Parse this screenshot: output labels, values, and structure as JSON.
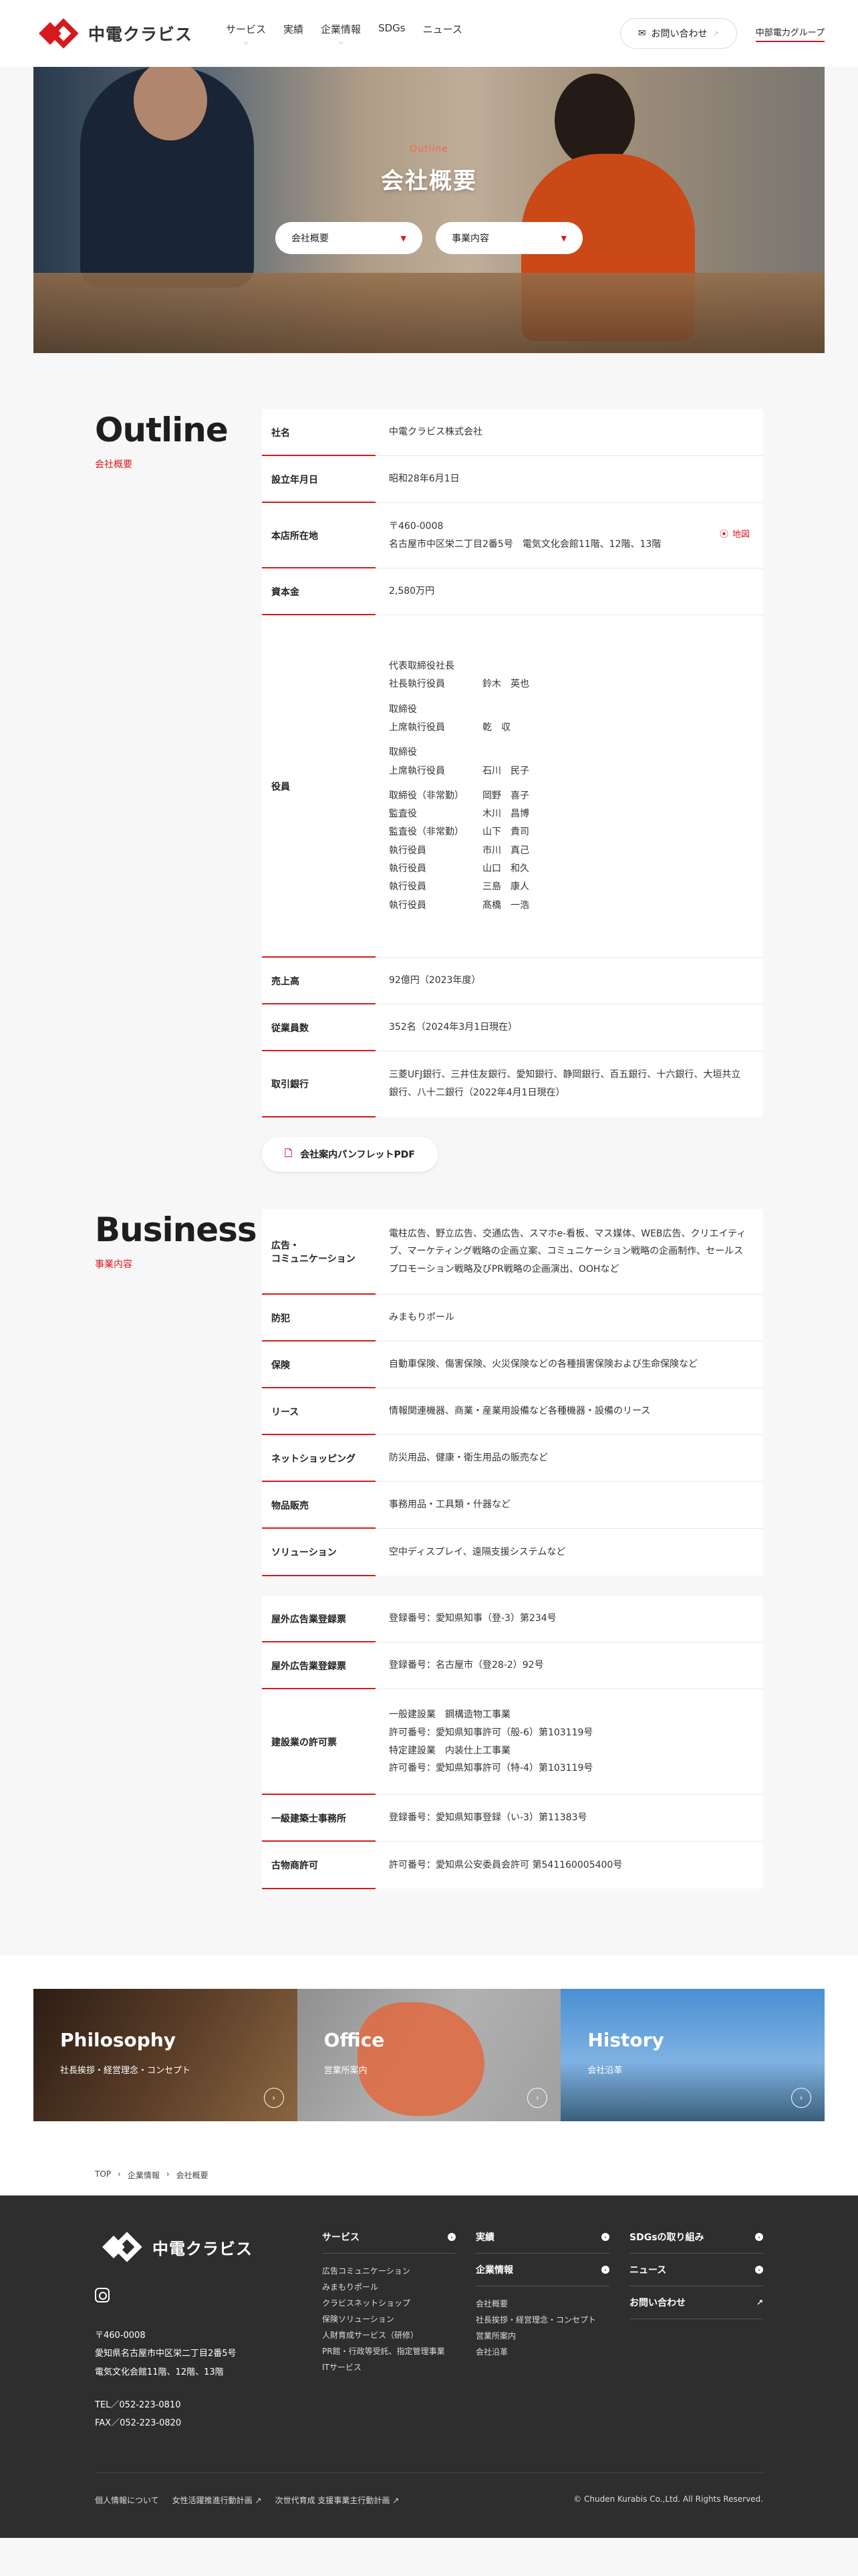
{
  "header": {
    "logo_text": "中電クラビス",
    "nav": [
      {
        "label": "サービス",
        "has_dropdown": true
      },
      {
        "label": "実績",
        "has_dropdown": false
      },
      {
        "label": "企業情報",
        "has_dropdown": true
      },
      {
        "label": "SDGs",
        "has_dropdown": false
      },
      {
        "label": "ニュース",
        "has_dropdown": false
      }
    ],
    "contact_label": "お問い合わせ",
    "group_label": "中部電力グループ"
  },
  "hero": {
    "subtitle": "Outline",
    "title": "会社概要",
    "select1": "会社概要",
    "select2": "事業内容"
  },
  "outline": {
    "title": "Outline",
    "subtitle": "会社概要",
    "rows": {
      "name": {
        "label": "社名",
        "value": "中電クラビス株式会社"
      },
      "founded": {
        "label": "設立年月日",
        "value": "昭和28年6月1日"
      },
      "address": {
        "label": "本店所在地",
        "line1": "〒460-0008",
        "line2": "名古屋市中区栄二丁目2番5号　電気文化会館11階、12階、13階",
        "map_label": "地図"
      },
      "capital": {
        "label": "資本金",
        "value": "2,580万円"
      },
      "officers": {
        "label": "役員"
      },
      "sales": {
        "label": "売上高",
        "value": "92億円（2023年度）"
      },
      "employees": {
        "label": "従業員数",
        "value": "352名（2024年3月1日現在）"
      },
      "banks": {
        "label": "取引銀行",
        "value": "三菱UFJ銀行、三井住友銀行、愛知銀行、静岡銀行、百五銀行、十六銀行、大垣共立銀行、八十二銀行（2022年4月1日現在）"
      }
    },
    "officers": {
      "g1_title": "代表取締役社長",
      "g1_role": "社長執行役員",
      "g1_name": "鈴木　英也",
      "g2_title": "取締役",
      "g2_role": "上席執行役員",
      "g2_name": "乾　収",
      "g3_title": "取締役",
      "g3_role": "上席執行役員",
      "g3_name": "石川　民子",
      "l1_role": "取締役（非常勤）",
      "l1_name": "岡野　喜子",
      "l2_role": "監査役",
      "l2_name": "木川　昌博",
      "l3_role": "監査役（非常勤）",
      "l3_name": "山下　貴司",
      "l4_role": "執行役員",
      "l4_name": "市川　真己",
      "l5_role": "執行役員",
      "l5_name": "山口　和久",
      "l6_role": "執行役員",
      "l6_name": "三島　康人",
      "l7_role": "執行役員",
      "l7_name": "髙橋　一浩"
    },
    "pdf_label": "会社案内パンフレットPDF"
  },
  "business": {
    "title": "Business",
    "subtitle": "事業内容",
    "rows": {
      "ad": {
        "label_l1": "広告・",
        "label_l2": "コミュニケーション",
        "value": "電柱広告、野立広告、交通広告、スマホe-看板、マス媒体、WEB広告、クリエイティブ、マーケティング戦略の企画立案、コミュニケーション戦略の企画制作、セールスプロモーション戦略及びPR戦略の企画演出、OOHなど"
      },
      "security": {
        "label": "防犯",
        "value": "みまもりポール"
      },
      "insurance": {
        "label": "保険",
        "value": "自動車保険、傷害保険、火災保険などの各種損害保険および生命保険など"
      },
      "lease": {
        "label": "リース",
        "value": "情報関連機器、商業・産業用設備など各種機器・設備のリース"
      },
      "shopping": {
        "label": "ネットショッピング",
        "value": "防災用品、健康・衛生用品の販売など"
      },
      "goods": {
        "label": "物品販売",
        "value": "事務用品・工具類・什器など"
      },
      "solution": {
        "label": "ソリューション",
        "value": "空中ディスプレイ、遠隔支援システムなど"
      }
    },
    "licenses": {
      "outdoor1": {
        "label": "屋外広告業登録票",
        "value": "登録番号：愛知県知事（登-3）第234号"
      },
      "outdoor2": {
        "label": "屋外広告業登録票",
        "value": "登録番号：名古屋市（登28-2）92号"
      },
      "construction": {
        "label": "建設業の許可票",
        "v1": "一般建設業　鋼構造物工事業",
        "v2": "許可番号：愛知県知事許可（般-6）第103119号",
        "v3": "特定建設業　内装仕上工事業",
        "v4": "許可番号：愛知県知事許可（特-4）第103119号"
      },
      "architect": {
        "label": "一級建築士事務所",
        "value": "登録番号：愛知県知事登録（い-3）第11383号"
      },
      "antique": {
        "label": "古物商許可",
        "value": "許可番号：愛知県公安委員会許可 第541160005400号"
      }
    }
  },
  "cards": [
    {
      "title": "Philosophy",
      "sub": "社長挨拶・経営理念・コンセプト"
    },
    {
      "title": "Office",
      "sub": "営業所案内"
    },
    {
      "title": "History",
      "sub": "会社沿革"
    }
  ],
  "breadcrumb": [
    "TOP",
    "企業情報",
    "会社概要"
  ],
  "footer": {
    "logo_text": "中電クラビス",
    "postal": "〒460-0008",
    "addr1": "愛知県名古屋市中区栄二丁目2番5号",
    "addr2": "電気文化会館11階、12階、13階",
    "tel": "TEL／052-223-0810",
    "fax": "FAX／052-223-0820",
    "col1_head": "サービス",
    "col1_items": [
      "広告コミュニケーション",
      "みまもりポール",
      "クラビスネットショップ",
      "保険ソリューション",
      "人財育成サービス（研修）",
      "PR館・行政等受託、指定管理事業",
      "ITサービス"
    ],
    "col2_head1": "実績",
    "col2_head2": "企業情報",
    "col2_items": [
      "会社概要",
      "社長挨拶・経営理念・コンセプト",
      "営業所案内",
      "会社沿革"
    ],
    "col3_head1": "SDGsの取り組み",
    "col3_head2": "ニュース",
    "col3_head3": "お問い合わせ",
    "bottom_links": [
      "個人情報について",
      "女性活躍推進行動計画",
      "次世代育成 支援事業主行動計画"
    ],
    "copyright": "© Chuden Kurabis Co.,Ltd. All Rights Reserved."
  }
}
